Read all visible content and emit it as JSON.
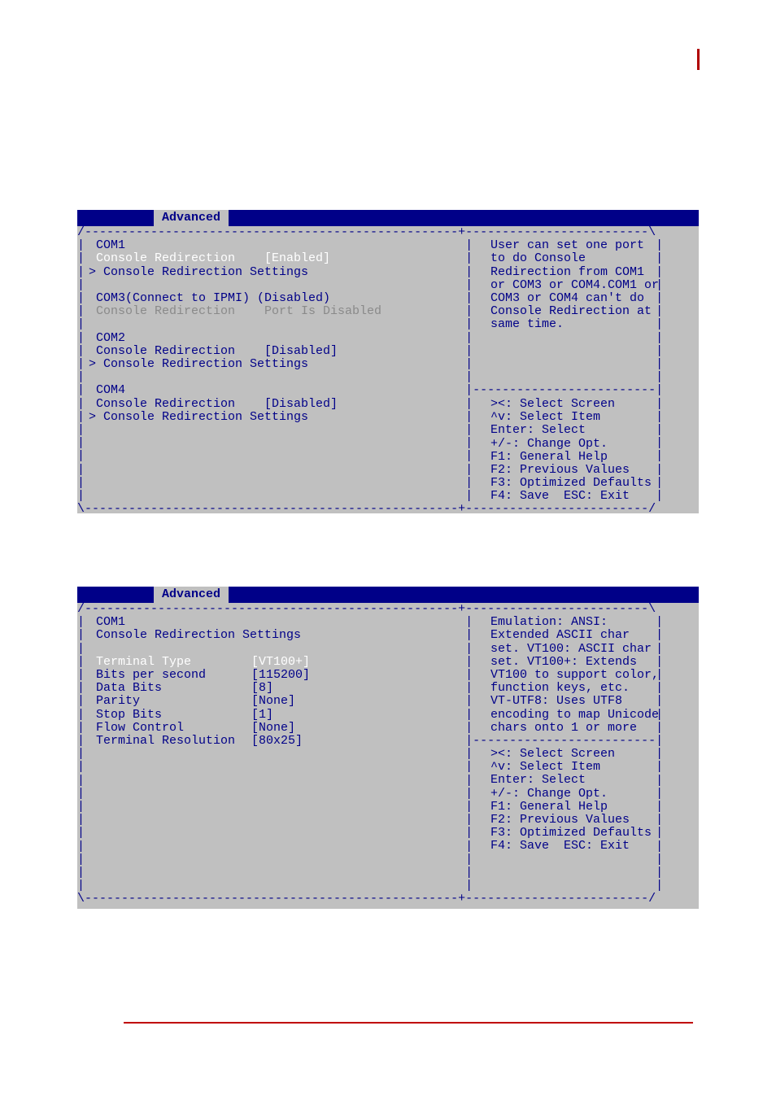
{
  "tab_label": "Advanced",
  "screen1": {
    "com1_header": " COM1",
    "com1_cr": " Console Redirection    [Enabled]",
    "com1_sub": " Console Redirection Settings",
    "com3_line1": " COM3(Connect to IPMI) (Disabled)",
    "com3_line2": " Console Redirection    Port Is Disabled",
    "com2_header": " COM2",
    "com2_cr": " Console Redirection    [Disabled]",
    "com2_sub": " Console Redirection Settings",
    "com4_header": " COM4",
    "com4_cr": " Console Redirection    [Disabled]",
    "com4_sub": " Console Redirection Settings",
    "help": [
      "User can set one port",
      "to do Console",
      "Redirection from COM1",
      "or COM3 or COM4.COM1 or",
      "COM3 or COM4 can't do",
      "Console Redirection at",
      "same time."
    ],
    "keys": [
      "><: Select Screen",
      "^v: Select Item",
      "Enter: Select",
      "+/-: Change Opt.",
      "F1: General Help",
      "F2: Previous Values",
      "F3: Optimized Defaults",
      "F4: Save  ESC: Exit"
    ]
  },
  "screen2": {
    "header1": " COM1",
    "header2": " Console Redirection Settings",
    "items": [
      {
        "label": " Terminal Type",
        "value": "[VT100+]"
      },
      {
        "label": " Bits per second",
        "value": "[115200]"
      },
      {
        "label": " Data Bits",
        "value": "[8]"
      },
      {
        "label": " Parity",
        "value": "[None]"
      },
      {
        "label": " Stop Bits",
        "value": "[1]"
      },
      {
        "label": " Flow Control",
        "value": "[None]"
      },
      {
        "label": " Terminal Resolution",
        "value": "[80x25]"
      }
    ],
    "help": [
      "Emulation: ANSI:",
      "Extended ASCII char",
      "set. VT100: ASCII char",
      "set. VT100+: Extends",
      "VT100 to support color,",
      "function keys, etc.",
      "VT-UTF8: Uses UTF8",
      "encoding to map Unicode",
      "chars onto 1 or more"
    ],
    "keys": [
      "><: Select Screen",
      "^v: Select Item",
      "Enter: Select",
      "+/-: Change Opt.",
      "F1: General Help",
      "F2: Previous Values",
      "F3: Optimized Defaults",
      "F4: Save  ESC: Exit"
    ]
  }
}
